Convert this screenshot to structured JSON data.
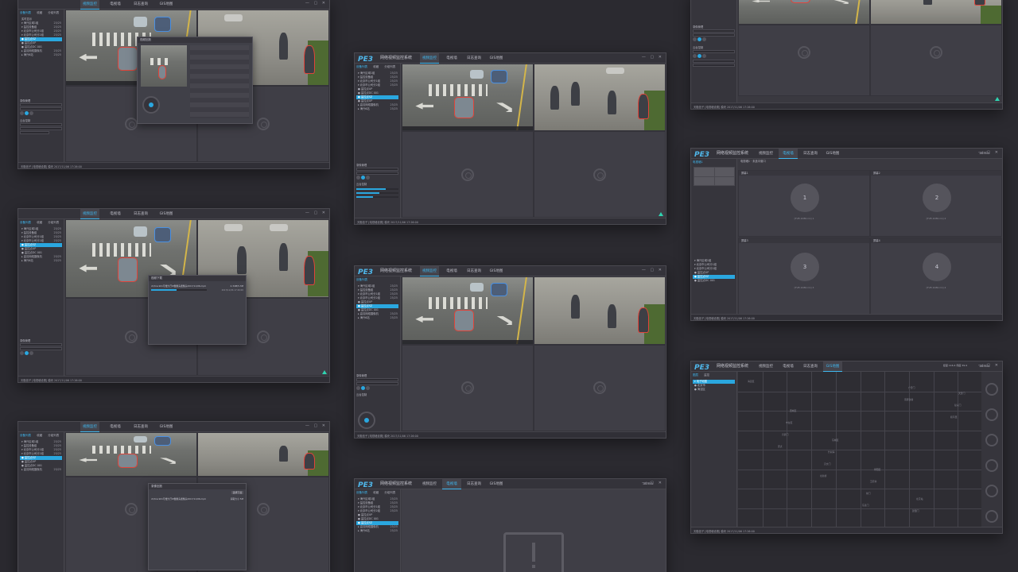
{
  "app": {
    "title": "网络视频监控系统",
    "nav_tabs": [
      "视频监控",
      "电视墙",
      "日志查询",
      "GIS地图"
    ],
    "user": "admin"
  },
  "sidebar": {
    "tabs": [
      "设备列表",
      "收藏",
      "分组列表"
    ],
    "tree": [
      {
        "label": "实时显示",
        "count": ""
      },
      {
        "label": "▾ 海兴区域1组",
        "count": "25/25"
      },
      {
        "label": "▾ 监控设备组",
        "count": "25/25"
      },
      {
        "label": "▾ 北京市公司分1组",
        "count": "25/25"
      },
      {
        "label": "  ▾ 北京市公司分2组",
        "count": "25/25"
      },
      {
        "label": "  ● 监控点SZ",
        "count": ""
      },
      {
        "label": "  ● 监控点UP",
        "count": ""
      },
      {
        "label": "  ● 监控点DC 001",
        "count": ""
      },
      {
        "label": "▸ 高清网络摄像机",
        "count": "25/25"
      },
      {
        "label": "▸ 海兴6站",
        "count": "25/25"
      }
    ],
    "section_label": "录像管理",
    "ptz_label": "云台控制",
    "presets_label": "预置点",
    "time_start": "2017-11-01 14:20:00",
    "time_end": "2017-11-01 14:20:00"
  },
  "status": {
    "text": "天融信子 [电视墙设置] 模块    2017/11/06  17:26:00"
  },
  "dialogs": {
    "playback_title": "视频回放",
    "download_title": "视频下载",
    "file_name": "ch/track01号楼大厅IP摄像头摄像头2017/11/06.mp4",
    "size_text": "2.34M/5.3M",
    "progress_pct": 45,
    "time_text": "2017/11/06 17:26:00",
    "record_title": "录像回放",
    "record_action": "选择下载",
    "record_size": "获取大小 5M"
  },
  "tvwall": {
    "header": "电视墙1 · 未选中窗口",
    "layout_label": "电视墙1",
    "screens": [
      {
        "title": "屏幕1",
        "num": "1",
        "sub": "[TVE-1080-C1] 1"
      },
      {
        "title": "屏幕2",
        "num": "2",
        "sub": "[TVE-1080-C1] 2"
      },
      {
        "title": "屏幕3",
        "num": "3",
        "sub": "[TVE-1080-C1] 3"
      },
      {
        "title": "屏幕4",
        "num": "4",
        "sub": "[TVE-1080-C1] 4"
      }
    ]
  },
  "map": {
    "tabs": [
      "图层",
      "监控"
    ],
    "tree": [
      {
        "label": "▾ 电子地图",
        "count": ""
      },
      {
        "label": "  ● 北京市",
        "count": ""
      },
      {
        "label": "  ● 海淀区",
        "count": ""
      }
    ],
    "coords": "经度 116.4  纬度 39.9",
    "labels": [
      "海淀区",
      "西城区",
      "东城区",
      "朝阳区",
      "北京站",
      "天安门",
      "丰台区",
      "什刹海",
      "王府井",
      "建国门",
      "复兴门",
      "宣武门",
      "崇文门",
      "前门",
      "广安门",
      "和平里",
      "安贞",
      "北新桥",
      "东直门",
      "南锣鼓巷"
    ]
  },
  "colors": {
    "accent": "#2aa7df",
    "alert": "#e0443a",
    "bg": "#2b2a30"
  }
}
